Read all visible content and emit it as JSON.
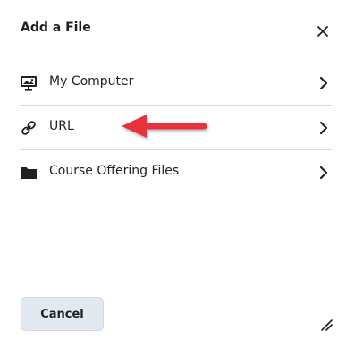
{
  "dialog": {
    "title": "Add a File",
    "close_icon": "close-icon",
    "items": [
      {
        "label": "My Computer",
        "icon": "monitor-image-icon"
      },
      {
        "label": "URL",
        "icon": "link-icon"
      },
      {
        "label": "Course Offering Files",
        "icon": "folder-icon"
      }
    ],
    "cancel_label": "Cancel",
    "resize_icon": "resize-handle-icon"
  },
  "colors": {
    "text": "#202122",
    "divider": "#d3d9e3",
    "button_bg": "#e3e9f1",
    "annotation_arrow": "#e8323a"
  }
}
